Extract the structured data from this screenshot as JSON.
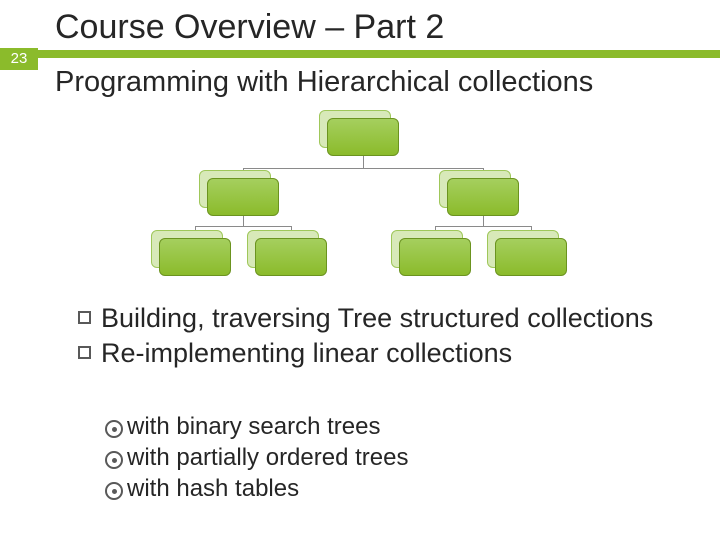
{
  "slide": {
    "number": "23",
    "title": "Course Overview – Part 2",
    "subtitle": "Programming with Hierarchical collections"
  },
  "bullets": {
    "b1": "Building, traversing Tree structured collections",
    "b2": "Re-implementing linear collections"
  },
  "subbullets": {
    "s1": "with binary search trees",
    "s2": "with partially ordered trees",
    "s3": "with hash tables"
  }
}
